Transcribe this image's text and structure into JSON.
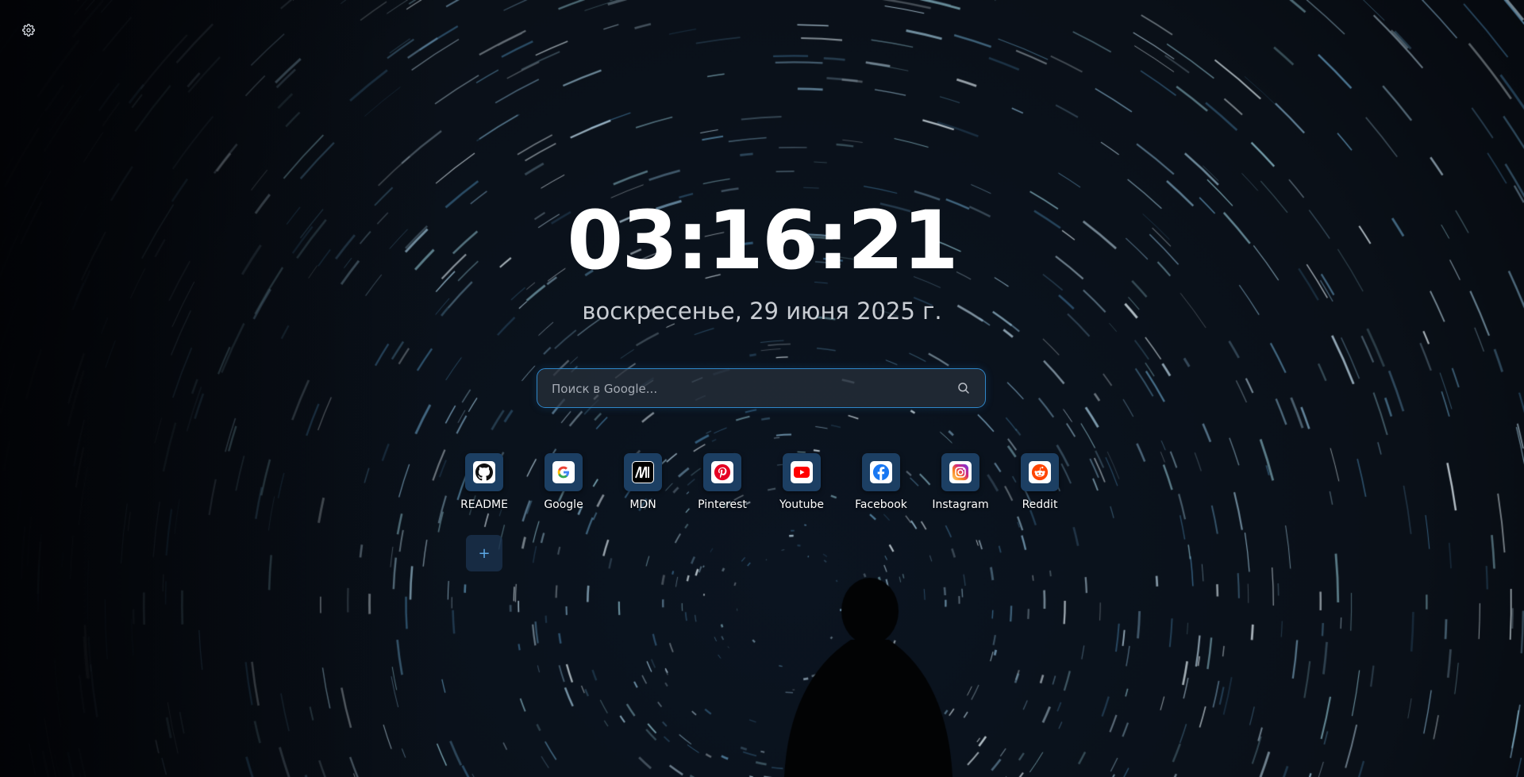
{
  "settings": {
    "icon": "gear-icon"
  },
  "clock": {
    "time": "03:16:21"
  },
  "date": {
    "text": "воскресенье, 29 июня 2025 г."
  },
  "search": {
    "placeholder": "Поиск в Google...",
    "value": "",
    "icon": "search-icon"
  },
  "shortcuts": [
    {
      "label": "README",
      "icon": "github-icon",
      "color": "#ffffff"
    },
    {
      "label": "Google",
      "icon": "google-icon",
      "color": "#ffffff"
    },
    {
      "label": "MDN",
      "icon": "mdn-icon",
      "color": "#000000"
    },
    {
      "label": "Pinterest",
      "icon": "pinterest-icon",
      "color": "#e60023"
    },
    {
      "label": "Youtube",
      "icon": "youtube-icon",
      "color": "#ff0000"
    },
    {
      "label": "Facebook",
      "icon": "facebook-icon",
      "color": "#1877f2"
    },
    {
      "label": "Instagram",
      "icon": "instagram-icon",
      "color": "#d62976"
    },
    {
      "label": "Reddit",
      "icon": "reddit-icon",
      "color": "#ff4500"
    }
  ],
  "add_shortcut": {
    "label": "+",
    "icon": "plus-icon"
  },
  "colors": {
    "accent": "#2f86c8",
    "tile": "#1c3f63",
    "background": "#05080d"
  }
}
